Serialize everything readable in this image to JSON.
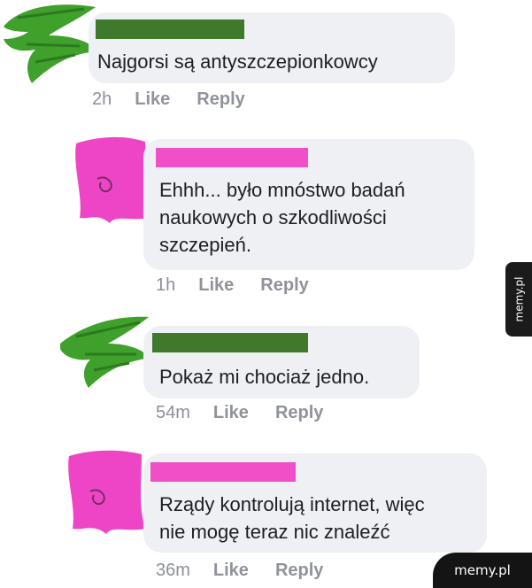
{
  "comments": [
    {
      "text": "Najgorsi są antyszczepionkowcy",
      "time": "2h",
      "like": "Like",
      "reply": "Reply"
    },
    {
      "text": "Ehhh... było mnóstwo badań\nnaukowych o szkodliwości\nszczepień.",
      "time": "1h",
      "like": "Like",
      "reply": "Reply"
    },
    {
      "text": "Pokaż mi chociaż jedno.",
      "time": "54m",
      "like": "Like",
      "reply": "Reply"
    },
    {
      "text": "Rządy kontrolują internet, więc\nnie mogę teraz nic znaleźć",
      "time": "36m",
      "like": "Like",
      "reply": "Reply"
    }
  ],
  "watermark": {
    "side": "memy.pl",
    "corner": "memy.pl"
  },
  "colors": {
    "green_censor": "#3f7a2c",
    "pink_censor": "#f04fc8",
    "bubble": "#eef0f3",
    "green_avatar": "#3fa02b",
    "pink_avatar": "#ee45c6"
  },
  "icons": {
    "avatar_a": "green-scribble-avatar-icon",
    "avatar_b": "pink-scribble-avatar-icon"
  }
}
